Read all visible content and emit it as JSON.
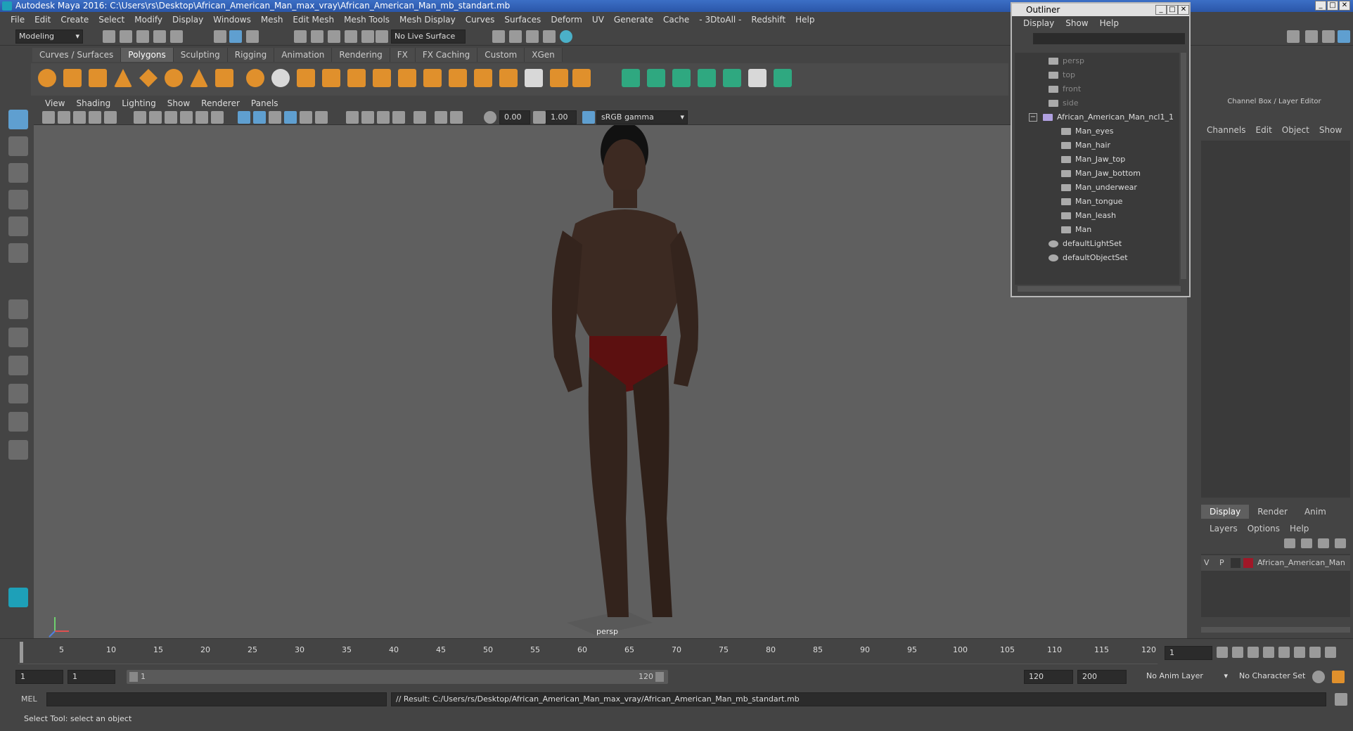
{
  "window": {
    "title": "Autodesk Maya 2016: C:\\Users\\rs\\Desktop\\African_American_Man_max_vray\\African_American_Man_mb_standart.mb"
  },
  "menubar": [
    "File",
    "Edit",
    "Create",
    "Select",
    "Modify",
    "Display",
    "Windows",
    "Mesh",
    "Edit Mesh",
    "Mesh Tools",
    "Mesh Display",
    "Curves",
    "Surfaces",
    "Deform",
    "UV",
    "Generate",
    "Cache",
    "- 3DtoAll -",
    "Redshift",
    "Help"
  ],
  "status_line": {
    "mode": "Modeling",
    "live_surface": "No Live Surface"
  },
  "shelf_tabs": [
    {
      "label": "Curves / Surfaces",
      "active": false
    },
    {
      "label": "Polygons",
      "active": true
    },
    {
      "label": "Sculpting",
      "active": false
    },
    {
      "label": "Rigging",
      "active": false
    },
    {
      "label": "Animation",
      "active": false
    },
    {
      "label": "Rendering",
      "active": false
    },
    {
      "label": "FX",
      "active": false
    },
    {
      "label": "FX Caching",
      "active": false
    },
    {
      "label": "Custom",
      "active": false
    },
    {
      "label": "XGen",
      "active": false
    }
  ],
  "viewport": {
    "menu": [
      "View",
      "Shading",
      "Lighting",
      "Show",
      "Renderer",
      "Panels"
    ],
    "exposure": "0.00",
    "gamma": "1.00",
    "color_space": "sRGB gamma",
    "camera_label": "persp"
  },
  "outliner": {
    "title": "Outliner",
    "menu": [
      "Display",
      "Show",
      "Help"
    ],
    "items": [
      {
        "label": "persp",
        "dim": true,
        "icon": "camera-icon"
      },
      {
        "label": "top",
        "dim": true,
        "icon": "camera-icon"
      },
      {
        "label": "front",
        "dim": true,
        "icon": "camera-icon"
      },
      {
        "label": "side",
        "dim": true,
        "icon": "camera-icon"
      },
      {
        "label": "African_American_Man_ncl1_1",
        "dim": false,
        "icon": "group-icon"
      },
      {
        "label": "Man_eyes",
        "dim": false,
        "icon": "mesh-icon"
      },
      {
        "label": "Man_hair",
        "dim": false,
        "icon": "mesh-icon"
      },
      {
        "label": "Man_Jaw_top",
        "dim": false,
        "icon": "mesh-icon"
      },
      {
        "label": "Man_Jaw_bottom",
        "dim": false,
        "icon": "mesh-icon"
      },
      {
        "label": "Man_underwear",
        "dim": false,
        "icon": "mesh-icon"
      },
      {
        "label": "Man_tongue",
        "dim": false,
        "icon": "mesh-icon"
      },
      {
        "label": "Man_leash",
        "dim": false,
        "icon": "mesh-icon"
      },
      {
        "label": "Man",
        "dim": false,
        "icon": "mesh-icon"
      },
      {
        "label": "defaultLightSet",
        "dim": false,
        "icon": "set-icon"
      },
      {
        "label": "defaultObjectSet",
        "dim": false,
        "icon": "set-icon"
      }
    ]
  },
  "channel_box": {
    "title": "Channel Box / Layer Editor",
    "menu": [
      "Channels",
      "Edit",
      "Object",
      "Show"
    ],
    "layer_tabs": [
      "Display",
      "Render",
      "Anim"
    ],
    "layer_menu": [
      "Layers",
      "Options",
      "Help"
    ],
    "layer": {
      "v": "V",
      "p": "P",
      "name": "African_American_Man",
      "color": "#a01828"
    }
  },
  "timeline": {
    "ticks": [
      "5",
      "10",
      "15",
      "20",
      "25",
      "30",
      "35",
      "40",
      "45",
      "50",
      "55",
      "60",
      "65",
      "70",
      "75",
      "80",
      "85",
      "90",
      "95",
      "100",
      "105",
      "110",
      "115",
      "120"
    ],
    "current_frame": "1"
  },
  "range": {
    "start": "1",
    "playback_start": "1",
    "slider_start": "1",
    "slider_end": "120",
    "playback_end": "120",
    "end": "200",
    "anim_layer": "No Anim Layer",
    "character_set": "No Character Set"
  },
  "command_line": {
    "lang": "MEL",
    "result": "// Result: C:/Users/rs/Desktop/African_American_Man_max_vray/African_American_Man_mb_standart.mb"
  },
  "help_line": "Select Tool: select an object",
  "colors": {
    "accent": "#5f9fd0",
    "title_bar": "#2a56a8",
    "layer_color": "#a01828"
  }
}
